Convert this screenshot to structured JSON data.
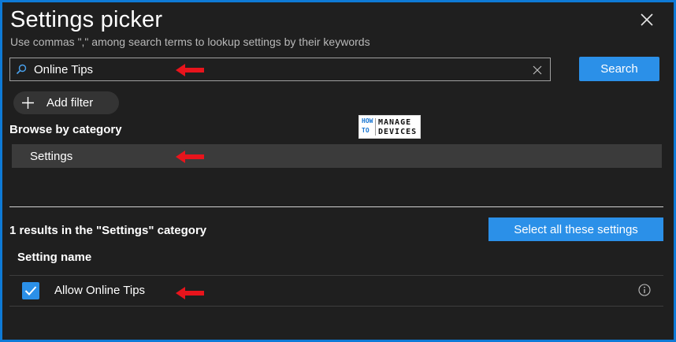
{
  "dialog": {
    "title": "Settings picker",
    "subtitle": "Use commas \",\" among search terms to lookup settings by their keywords"
  },
  "search": {
    "value": "Online Tips",
    "button_label": "Search"
  },
  "filter": {
    "add_filter_label": "Add filter"
  },
  "browse": {
    "heading": "Browse by category",
    "categories": [
      {
        "label": "Settings",
        "selected": true
      }
    ]
  },
  "watermark": {
    "line1_left": "HOW",
    "line2_left": "TO",
    "line1_right": "MANAGE",
    "line2_right": "DEVICES"
  },
  "results": {
    "summary": "1 results in the \"Settings\" category",
    "select_all_label": "Select all these settings",
    "column_header": "Setting name",
    "rows": [
      {
        "label": "Allow Online Tips",
        "checked": true
      }
    ]
  },
  "colors": {
    "accent": "#2b90e8",
    "background": "#1f1f1f",
    "frame": "#0e7ad6",
    "annotation_arrow": "#e8141c"
  }
}
